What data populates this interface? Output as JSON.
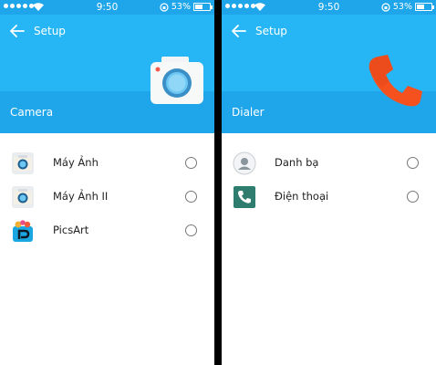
{
  "left_screen": {
    "status": {
      "time": "9:50",
      "battery": "53%",
      "battery_level": 0.53
    },
    "header": {
      "title": "Setup",
      "section": "Camera",
      "hero_icon": "camera-icon"
    },
    "apps": [
      {
        "label": "Máy Ảnh",
        "icon": "camera-app-icon"
      },
      {
        "label": "Máy Ảnh II",
        "icon": "camera-app-icon"
      },
      {
        "label": "PicsArt",
        "icon": "picsart-icon"
      }
    ]
  },
  "right_screen": {
    "status": {
      "time": "9:50",
      "battery": "53%",
      "battery_level": 0.53
    },
    "header": {
      "title": "Setup",
      "section": "Dialer",
      "hero_icon": "phone-handset-icon"
    },
    "apps": [
      {
        "label": "Danh bạ",
        "icon": "contacts-icon"
      },
      {
        "label": "Điện thoại",
        "icon": "phone-app-icon"
      }
    ]
  },
  "colors": {
    "header": "#27b6f5",
    "header_band": "#1fa6ea",
    "divider": "#000000",
    "phone_accent": "#f4511e"
  }
}
